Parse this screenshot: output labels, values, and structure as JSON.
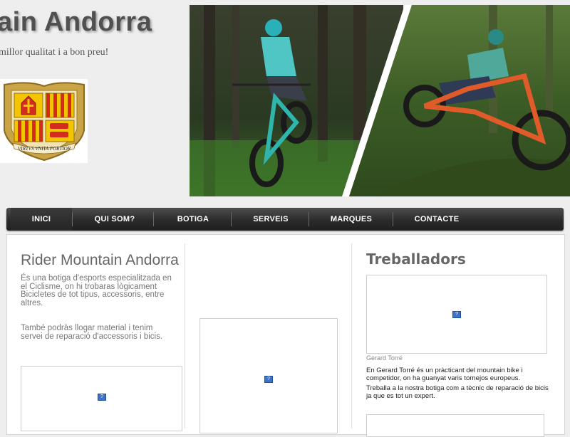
{
  "header": {
    "title": "ain Andorra",
    "tagline": "millor qualitat i a bon preu!"
  },
  "crest": {
    "motto": "VIRTVS VNITA FORTIOR"
  },
  "nav": {
    "items": [
      "INICI",
      "QUI SOM?",
      "BOTIGA",
      "SERVEIS",
      "MARQUES",
      "CONTACTE"
    ],
    "active": "INICI"
  },
  "colors": {
    "nav_bg": "#2b2b2b",
    "heading": "#666666",
    "crest_red": "#d42b1e",
    "crest_yellow": "#f2c500",
    "crest_blue": "#1d4fa0",
    "broken_image_icon": "#3d74c6"
  },
  "left": {
    "heading": "Rider Mountain Andorra",
    "p1": "És una botiga d'esports especialitzada en el  Ciclisme, on hi trobaras lògicament Bicicletes de tot tipus, accessoris, entre altres.",
    "p2": "També podràs llogar material i tenim servei de reparació d'accessoris i bicis."
  },
  "right": {
    "heading": "Treballadors",
    "caption": "Gerard Torré",
    "p1": "En Gerard Torré és un pràcticant del mountain bike i competidor, on ha guanyat varis tornejos europeus.",
    "p2": "Treballa a la nostra botiga com a tècnic de reparació de bicis ja que es tot un expert."
  },
  "broken_image_icon": "broken-image-icon"
}
